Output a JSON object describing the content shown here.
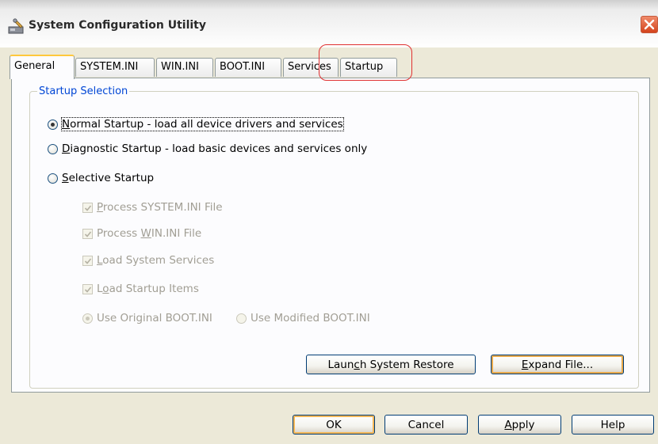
{
  "window": {
    "title": "System Configuration Utility",
    "icons": {
      "app": "system-config-icon",
      "close": "close-icon"
    },
    "colors": {
      "close_button": "#d4431c",
      "group_title": "#0046d5",
      "annotation": "#e03030"
    }
  },
  "tabs": [
    {
      "label": "General",
      "active": true
    },
    {
      "label": "SYSTEM.INI",
      "active": false
    },
    {
      "label": "WIN.INI",
      "active": false
    },
    {
      "label": "BOOT.INI",
      "active": false
    },
    {
      "label": "Services",
      "active": false
    },
    {
      "label": "Startup",
      "active": false
    }
  ],
  "group": {
    "title": "Startup Selection",
    "radios": [
      {
        "accel": "N",
        "rest": "ormal Startup - load all device drivers and services",
        "checked": true
      },
      {
        "accel": "D",
        "rest": "iagnostic Startup - load basic devices and services only",
        "checked": false
      },
      {
        "accel": "S",
        "rest": "elective Startup",
        "checked": false
      }
    ],
    "checks": [
      {
        "pre": "",
        "accel": "P",
        "rest": "rocess SYSTEM.INI File",
        "checked": true
      },
      {
        "pre": "Process ",
        "accel": "W",
        "rest": "IN.INI File",
        "checked": true
      },
      {
        "pre": "",
        "accel": "L",
        "rest": "oad System Services",
        "checked": true
      },
      {
        "pre": "L",
        "accel": "o",
        "rest": "ad Startup Items",
        "checked": true
      }
    ],
    "boot_radios": [
      {
        "label": "Use Original BOOT.INI",
        "checked": true
      },
      {
        "label": "Use Modified BOOT.INI",
        "checked": false
      }
    ],
    "buttons": {
      "launch_restore": {
        "pre": "Laun",
        "accel": "c",
        "rest": "h System Restore"
      },
      "expand_file": {
        "pre": "",
        "accel": "E",
        "rest": "xpand File..."
      }
    }
  },
  "footer": {
    "ok": "OK",
    "cancel": "Cancel",
    "apply": {
      "accel": "A",
      "rest": "pply"
    },
    "help": "Help"
  }
}
